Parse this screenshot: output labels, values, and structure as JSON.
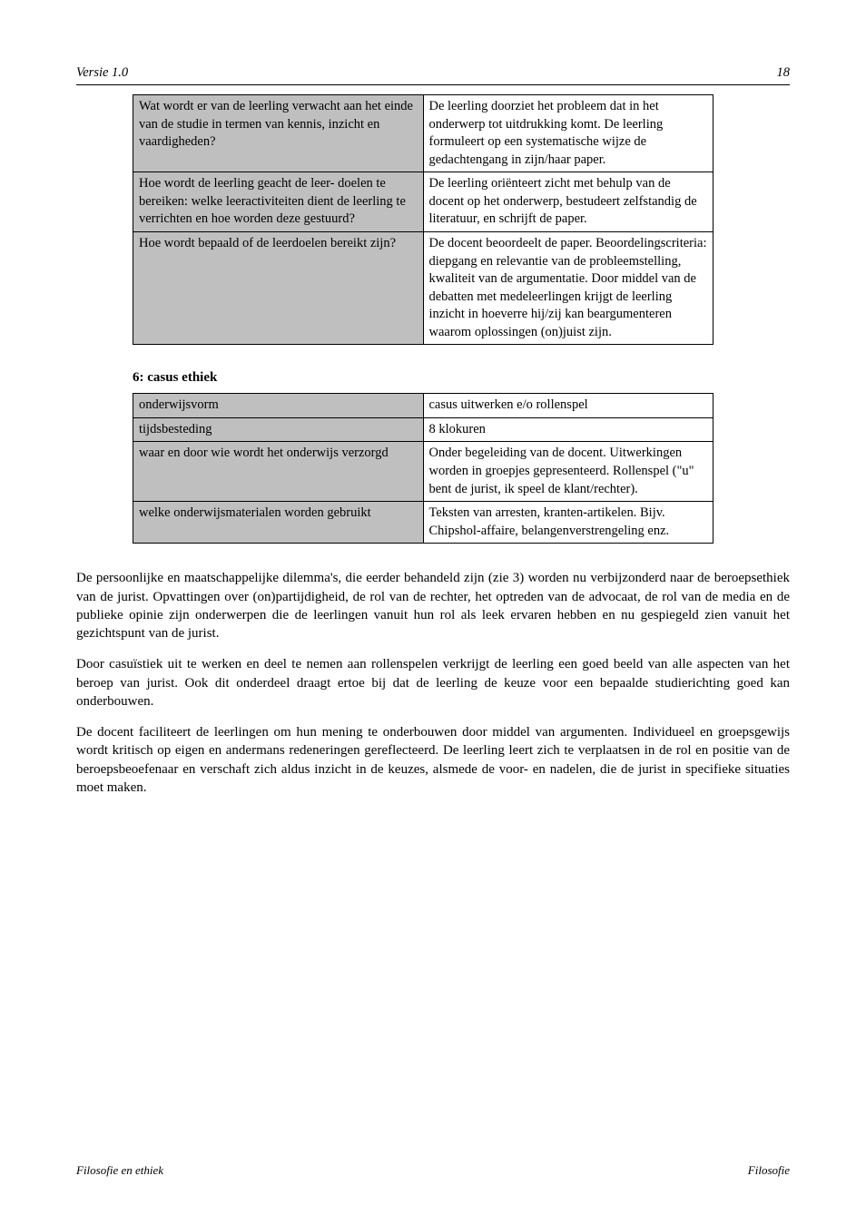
{
  "header": {
    "left": "Versie 1.0",
    "right": "18"
  },
  "table1": {
    "rows": [
      {
        "label": "Wat wordt er van de leerling verwacht aan het einde van de studie in termen van kennis, inzicht en vaardigheden?",
        "value": "De leerling doorziet het probleem dat in het onderwerp tot uitdrukking komt. De leerling formuleert op een systematische wijze de gedachtengang in zijn/haar paper."
      },
      {
        "label": "Hoe wordt de leerling geacht de leer-\ndoelen te bereiken: welke leeractiviteiten dient de leerling te verrichten en hoe worden deze gestuurd?",
        "value": "De leerling oriënteert zicht met behulp van de docent op het onderwerp, bestudeert zelfstandig de literatuur, en schrijft de paper."
      },
      {
        "label": "Hoe wordt bepaald of de leerdoelen bereikt zijn?",
        "value": "De docent beoordeelt de paper. Beoordelingscriteria: diepgang en relevantie van de probleemstelling, kwaliteit van de argumentatie. Door middel van de debatten met medeleerlingen krijgt de leerling inzicht in hoeverre hij/zij kan beargumenteren waarom oplossingen (on)juist zijn."
      }
    ]
  },
  "table2": {
    "title": "6: casus ethiek",
    "rows": [
      {
        "label": "onderwijsvorm",
        "value": "casus uitwerken e/o rollenspel"
      },
      {
        "label": "tijdsbesteding",
        "value": "8 klokuren"
      },
      {
        "label": "waar en door wie wordt het onderwijs verzorgd",
        "value": "Onder begeleiding van de docent. Uitwerkingen worden in groepjes gepresenteerd. Rollenspel (\"u\" bent de jurist, ik speel de klant/rechter)."
      },
      {
        "label": "welke onderwijsmaterialen worden gebruikt",
        "value": "Teksten van arresten, kranten-artikelen. Bijv. Chipshol-affaire, belangenverstrengeling enz."
      }
    ]
  },
  "body": {
    "p1": "De persoonlijke en maatschappelijke dilemma's, die eerder behandeld zijn (zie 3) worden nu verbijzonderd naar de beroepsethiek van de jurist. Opvattingen over (on)partijdigheid, de rol van de rechter, het optreden van de advocaat, de rol van de media en de publieke opinie zijn onderwerpen die de leerlingen vanuit hun rol als leek ervaren hebben en nu gespiegeld zien vanuit het gezichtspunt van de jurist.",
    "p2": "Door casuïstiek uit te werken en deel te nemen aan rollenspelen verkrijgt de leerling een goed beeld van alle aspecten van het beroep van jurist. Ook dit onderdeel draagt ertoe bij dat de leerling de keuze voor een bepaalde studierichting goed kan onderbouwen.",
    "p3": "De docent faciliteert de leerlingen om hun mening te onderbouwen door middel van argumenten. Individueel en groepsgewijs wordt kritisch op eigen en andermans redeneringen gereflecteerd. De leerling leert zich te verplaatsen in de rol en positie van de beroepsbeoefenaar en verschaft zich aldus inzicht in de keuzes, alsmede de voor- en nadelen, die de jurist in specifieke situaties moet maken."
  },
  "footer": {
    "left": "Filosofie en ethiek",
    "right": "Filosofie"
  }
}
